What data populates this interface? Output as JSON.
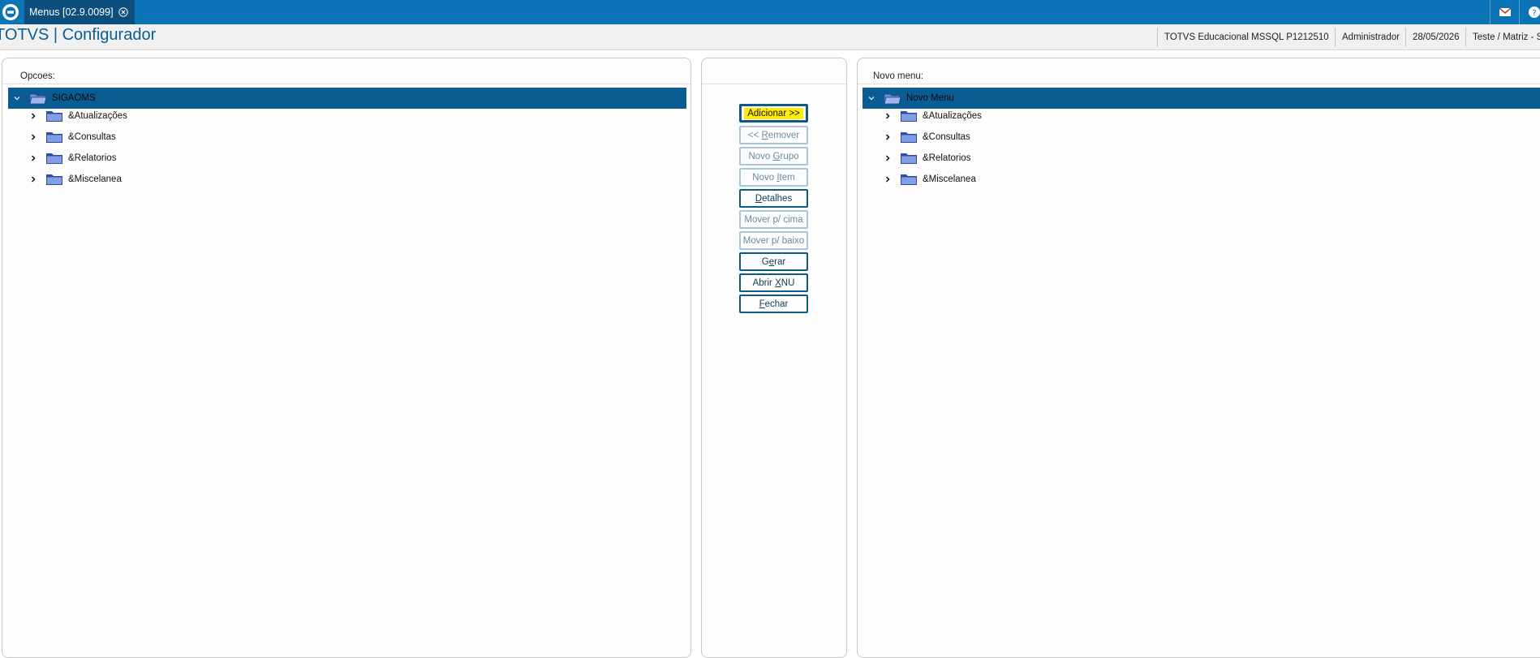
{
  "topbar": {
    "tab_title": "Menus [02.9.0099]",
    "icons": [
      "totvs-logo-icon",
      "close-tab-icon",
      "mail-icon",
      "help-icon"
    ]
  },
  "header": {
    "app_title": "TOTVS | Configurador",
    "environment": "TOTVS Educacional MSSQL P1212510",
    "user": "Administrador",
    "date": "28/05/2026",
    "company": "Teste / Matriz - Sp"
  },
  "left_panel": {
    "label": "Opcoes:",
    "root": "SIGAOMS",
    "items": [
      "&Atualizações",
      "&Consultas",
      "&Relatorios",
      "&Miscelanea"
    ]
  },
  "buttons": {
    "add": "Adicionar >>",
    "remove_a": "<< ",
    "remove_u": "R",
    "remove_b": "emover",
    "new_group_a": "Novo ",
    "new_group_u": "G",
    "new_group_b": "rupo",
    "new_item_a": "Novo ",
    "new_item_u": "I",
    "new_item_b": "tem",
    "details_u": "D",
    "details_b": "etalhes",
    "move_up": "Mover p/ cima",
    "move_down": "Mover p/ baixo",
    "generate_a": "G",
    "generate_u": "e",
    "generate_b": "rar",
    "open_xnu_a": "Abrir ",
    "open_xnu_u": "X",
    "open_xnu_b": "NU",
    "close_u": "F",
    "close_b": "echar"
  },
  "right_panel": {
    "label": "Novo menu:",
    "root": "Novo Menu",
    "items": [
      "&Atualizações",
      "&Consultas",
      "&Relatorios",
      "&Miscelanea"
    ]
  },
  "colors": {
    "topbar": "#0a74b6",
    "active_tab": "#0c4f7d",
    "selected_row": "#0b5c93",
    "button_border": "#0e5a86",
    "highlight": "#ffeb00"
  }
}
